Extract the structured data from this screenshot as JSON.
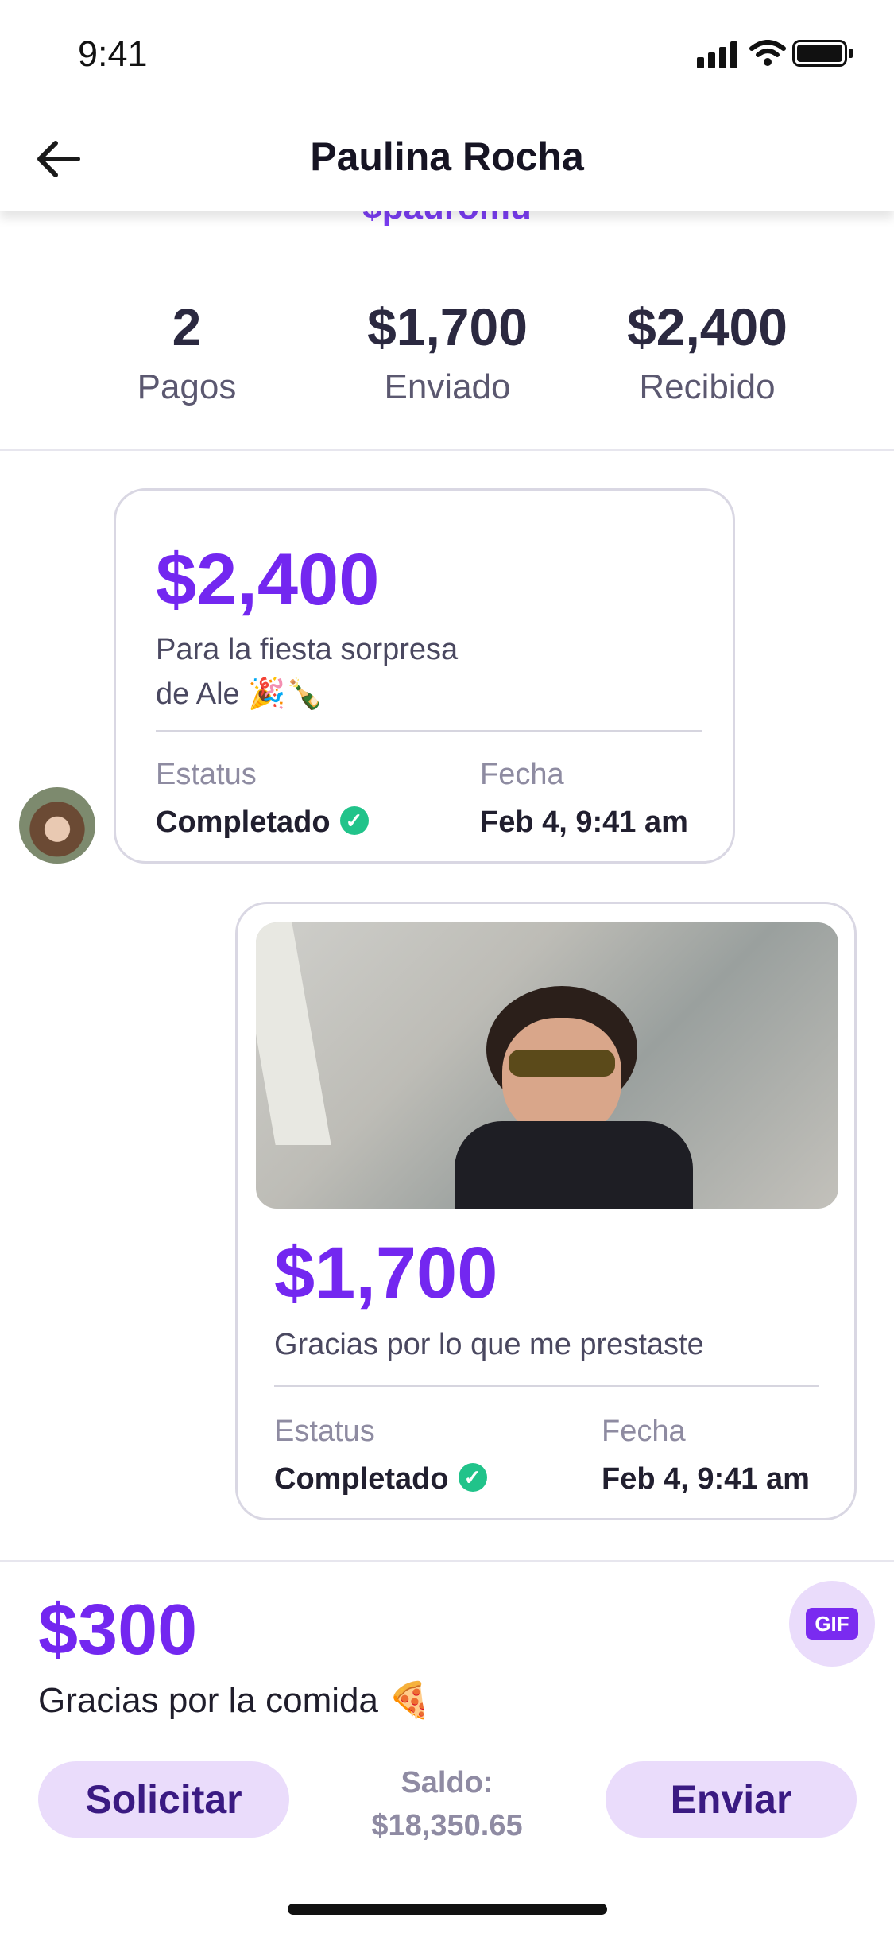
{
  "status_bar": {
    "time": "9:41"
  },
  "header": {
    "title": "Paulina Rocha",
    "handle": "$pauromu"
  },
  "stats": [
    {
      "value": "2",
      "label": "Pagos"
    },
    {
      "value": "$1,700",
      "label": "Enviado"
    },
    {
      "value": "$2,400",
      "label": "Recibido"
    }
  ],
  "payments": [
    {
      "amount": "$2,400",
      "note_line1": "Para la fiesta sorpresa",
      "note_line2": "de Ale 🎉🍾",
      "status_label": "Estatus",
      "status_value": "Completado",
      "date_label": "Fecha",
      "date_value": "Feb 4, 9:41 am"
    },
    {
      "amount": "$1,700",
      "note": "Gracias por lo que me prestaste",
      "status_label": "Estatus",
      "status_value": "Completado",
      "date_label": "Fecha",
      "date_value": "Feb 4, 9:41 am"
    }
  ],
  "composer": {
    "amount": "$300",
    "note": "Gracias por la comida 🍕",
    "gif_label": "GIF",
    "request_label": "Solicitar",
    "send_label": "Enviar",
    "balance_label": "Saldo:",
    "balance_value": "$18,350.65"
  },
  "colors": {
    "accent": "#7327f0",
    "pill_bg": "#eadcfb",
    "success": "#21c38a"
  }
}
